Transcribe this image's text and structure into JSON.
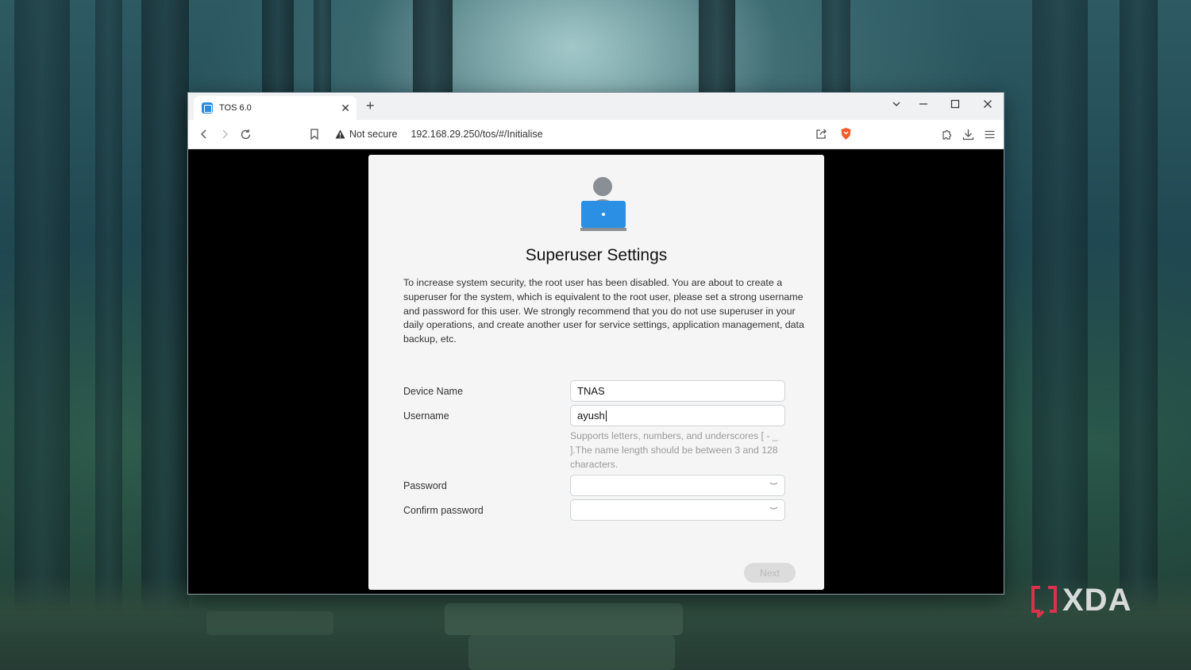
{
  "browser": {
    "tab": {
      "title": "TOS 6.0"
    },
    "new_tab_label": "+",
    "address": {
      "security_label": "Not secure",
      "url": "192.168.29.250/tos/#/Initialise"
    }
  },
  "dialog": {
    "title": "Superuser Settings",
    "description": "To increase system security, the root user has been disabled. You are about to create a superuser for the system, which is equivalent to the root user, please set a strong username and password for this user. We strongly recommend that you do not use superuser in your daily operations, and create another user for service settings, application management, data backup, etc.",
    "fields": {
      "device_name": {
        "label": "Device Name",
        "value": "TNAS"
      },
      "username": {
        "label": "Username",
        "value": "ayush",
        "hint": "Supports letters, numbers, and underscores [ - _ ].The name length should be between 3 and 128 characters."
      },
      "password": {
        "label": "Password",
        "value": ""
      },
      "confirm_password": {
        "label": "Confirm password",
        "value": ""
      }
    },
    "next_label": "Next",
    "accent_color": "#2b8fe3"
  },
  "watermark": {
    "text": "XDA",
    "color": "#d8334a"
  }
}
